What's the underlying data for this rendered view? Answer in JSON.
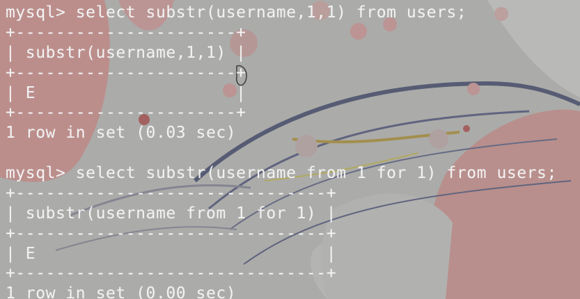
{
  "terminal": {
    "lines": [
      "mysql> select substr(username,1,1) from users;",
      "+----------------------+",
      "| substr(username,1,1) |",
      "+----------------------+",
      "| E                    |",
      "+----------------------+",
      "1 row in set (0.03 sec)",
      "",
      "mysql> select substr(username from 1 for 1) from users;",
      "+-------------------------------+",
      "| substr(username from 1 for 1) |",
      "+-------------------------------+",
      "| E                             |",
      "+-------------------------------+",
      "1 row in set (0.00 sec)"
    ]
  }
}
